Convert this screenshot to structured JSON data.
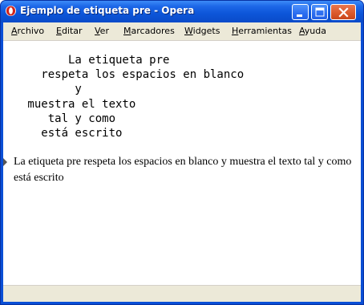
{
  "window": {
    "title": "Ejemplo de etiqueta pre - Opera",
    "app_icon": "opera-icon",
    "controls": {
      "minimize": "minimize-icon",
      "maximize": "maximize-icon",
      "close": "close-icon"
    }
  },
  "menu": {
    "items": [
      {
        "accel": "A",
        "rest": "rchivo"
      },
      {
        "accel": "E",
        "rest": "ditar"
      },
      {
        "accel": "V",
        "rest": "er"
      },
      {
        "accel": "M",
        "rest": "arcadores"
      },
      {
        "accel": "W",
        "rest": "idgets"
      },
      {
        "accel": "H",
        "rest": "erramientas"
      },
      {
        "accel": "A",
        "rest": "yuda"
      }
    ]
  },
  "content": {
    "pre_text": "       La etiqueta pre\n   respeta los espacios en blanco\n        y\n muestra el texto\n    tal y como\n   está escrito",
    "paragraph_text": "La etiqueta pre respeta los espacios en blanco y muestra el texto tal y como está escrito"
  },
  "colors": {
    "titlebar": "#0c55d8",
    "chrome": "#ece9d8",
    "page": "#ffffff"
  }
}
